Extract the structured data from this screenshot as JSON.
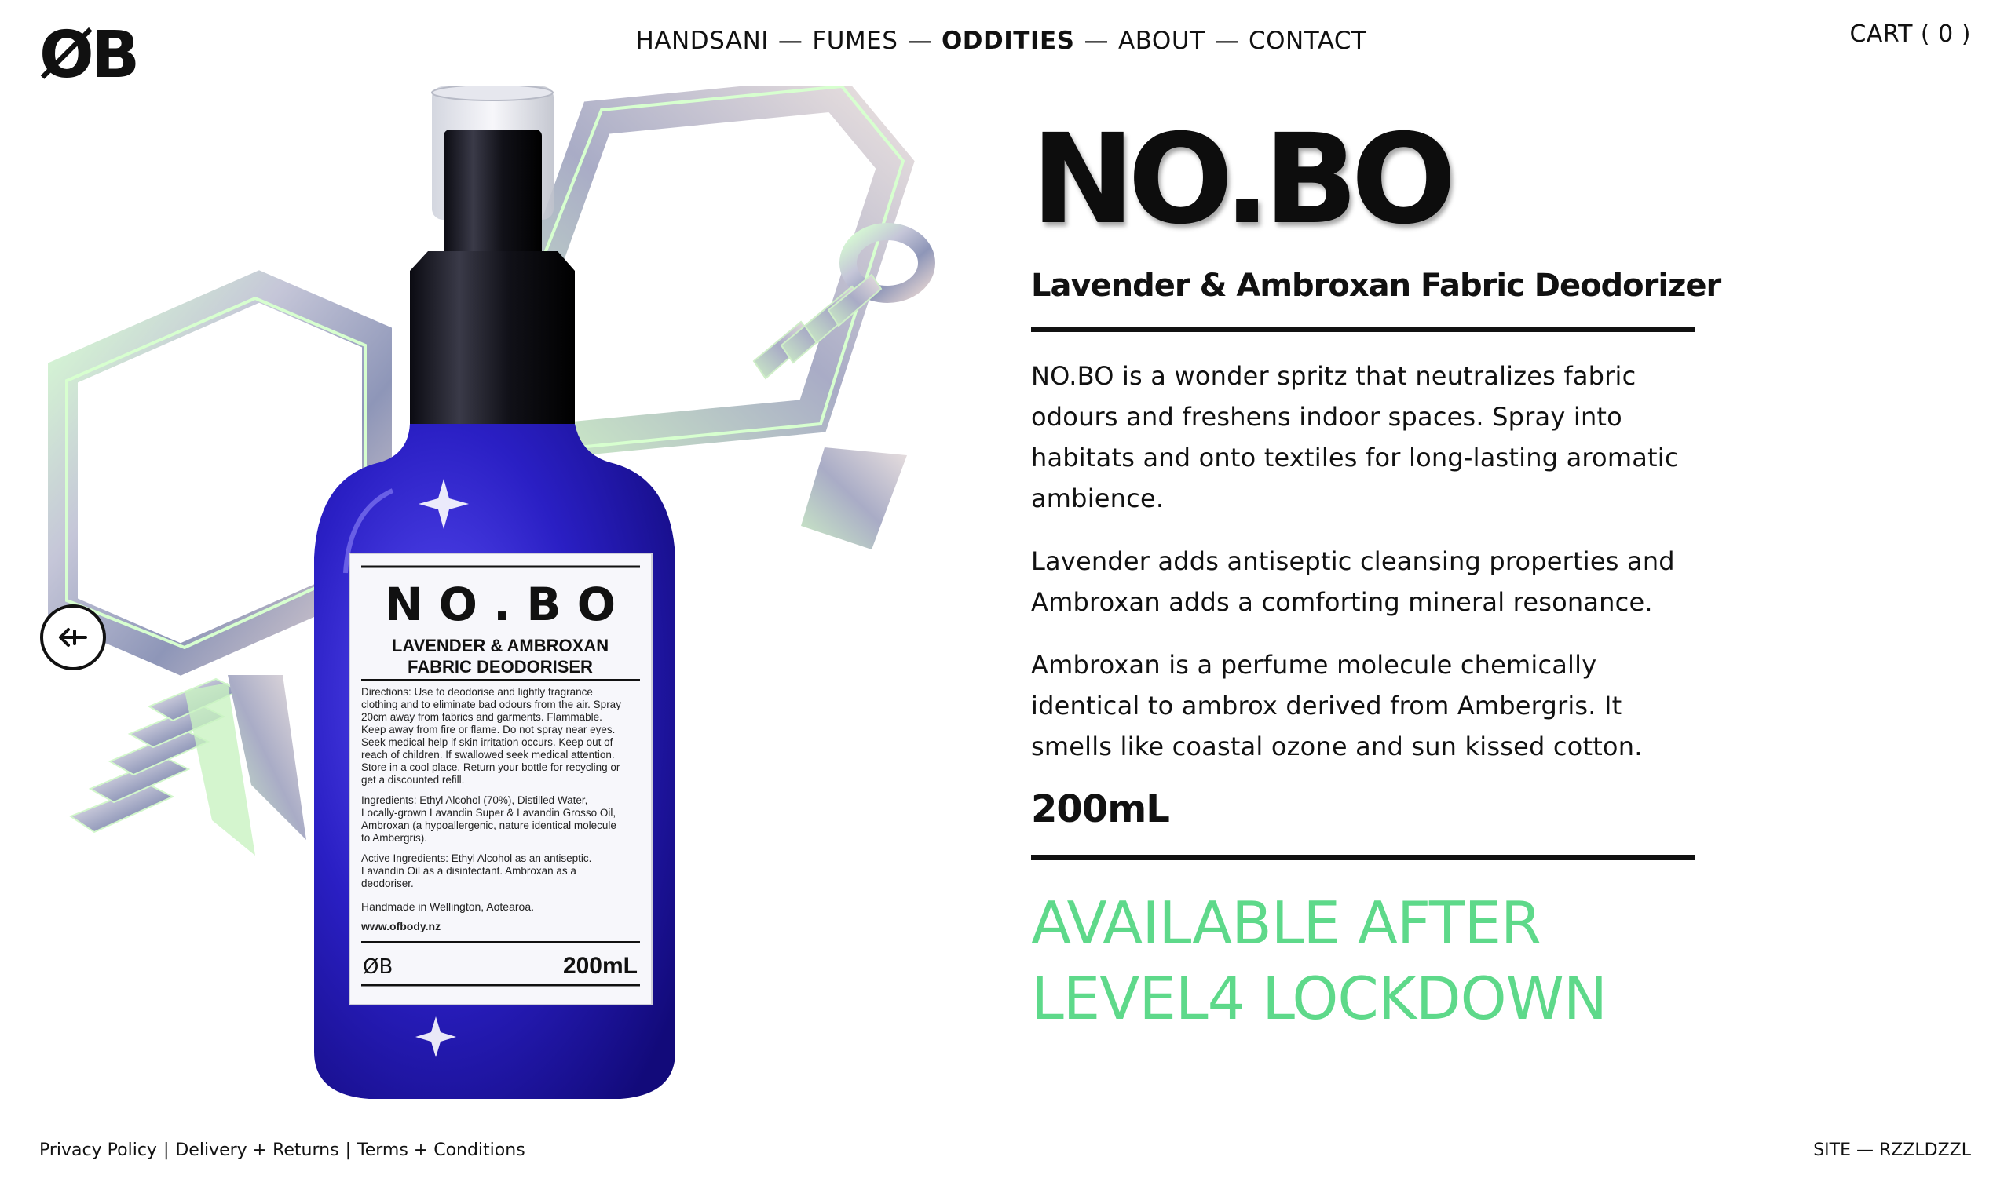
{
  "header": {
    "logo_text": "ØB",
    "nav": [
      {
        "label": "HANDSANI",
        "active": false
      },
      {
        "label": "FUMES",
        "active": false
      },
      {
        "label": "ODDITIES",
        "active": true
      },
      {
        "label": "ABOUT",
        "active": false
      },
      {
        "label": "CONTACT",
        "active": false
      }
    ],
    "nav_separator": "—",
    "cart_label": "CART ( 0 )"
  },
  "product": {
    "title": "NO.BO",
    "subtitle": "Lavender & Ambroxan Fabric Deodorizer",
    "description": [
      "NO.BO is a wonder spritz that neutralizes fabric odours and freshens indoor spaces. Spray into habitats and onto textiles for long-lasting aromatic ambience.",
      "Lavender adds antiseptic cleansing properties and Ambroxan adds a comforting mineral resonance.",
      "Ambroxan is a perfume molecule chemically identical to ambrox derived from Ambergris. It smells like coastal ozone and sun kissed cotton."
    ],
    "volume": "200mL",
    "availability": [
      "AVAILABLE AFTER",
      "LEVEL4 LOCKDOWN"
    ]
  },
  "bottle_label": {
    "brand": "N O . B O",
    "name_line1": "LAVENDER & AMBROXAN",
    "name_line2": "FABRIC DEODORISER",
    "directions": [
      "Directions: Use to deodorise and lightly fragrance",
      "clothing and to eliminate bad odours from the air. Spray",
      "20cm away from fabrics and garments. Flammable.",
      "Keep away from fire or flame. Do not spray near eyes.",
      "Seek medical help if skin irritation occurs. Keep out of",
      "reach of children. If swallowed seek medical attention.",
      "Store in a cool place. Return your bottle for recycling or",
      "get a discounted refill."
    ],
    "ingredients": [
      "Ingredients: Ethyl Alcohol (70%), Distilled Water,",
      "Locally-grown Lavandin Super & Lavandin Grosso Oil,",
      "Ambroxan (a hypoallergenic, nature identical molecule",
      "to Ambergris)."
    ],
    "active": [
      "Active Ingredients: Ethyl Alcohol as an antiseptic.",
      "Lavandin Oil as a disinfectant. Ambroxan as a",
      "deodoriser."
    ],
    "made_in": "Handmade in Wellington, Aotearoa.",
    "website": "www.ofbody.nz",
    "logo": "ØB",
    "volume": "200mL"
  },
  "footer": {
    "links": [
      "Privacy Policy",
      "Delivery + Returns",
      "Terms + Conditions"
    ],
    "site_credit": "SITE — RZZLDZZL"
  },
  "icons": {
    "prev": "arrow-left-icon"
  },
  "colors": {
    "accent_green": "#5ed98a",
    "bottle_blue": "#2a1fc4",
    "text": "#111111"
  }
}
